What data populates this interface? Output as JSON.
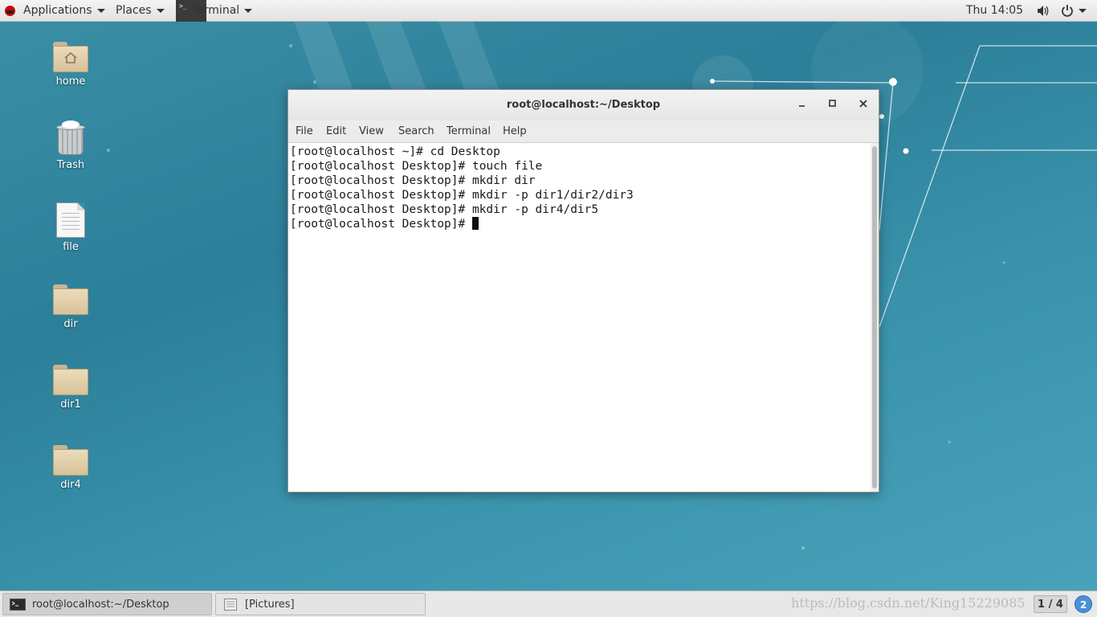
{
  "topbar": {
    "applications": "Applications",
    "places": "Places",
    "active_app": "Terminal",
    "clock": "Thu 14:05",
    "icons": [
      "redhat-logo-icon",
      "volume-icon",
      "power-icon",
      "chevron-down-icon"
    ]
  },
  "desktop": {
    "icons": [
      {
        "label": "home",
        "icon": "home-folder-icon"
      },
      {
        "label": "Trash",
        "icon": "trash-icon"
      },
      {
        "label": "file",
        "icon": "text-file-icon"
      },
      {
        "label": "dir",
        "icon": "folder-icon"
      },
      {
        "label": "dir1",
        "icon": "folder-icon"
      },
      {
        "label": "dir4",
        "icon": "folder-icon"
      }
    ]
  },
  "terminal_window": {
    "title": "root@localhost:~/Desktop",
    "controls": {
      "minimize": "minimize-icon",
      "maximize": "maximize-icon",
      "close": "close-icon"
    },
    "menu": [
      "File",
      "Edit",
      "View",
      "Search",
      "Terminal",
      "Help"
    ],
    "lines": [
      "[root@localhost ~]# cd Desktop",
      "[root@localhost Desktop]# touch file",
      "[root@localhost Desktop]# mkdir dir",
      "[root@localhost Desktop]# mkdir -p dir1/dir2/dir3",
      "[root@localhost Desktop]# mkdir -p dir4/dir5",
      "[root@localhost Desktop]# "
    ]
  },
  "taskbar": {
    "tasks": [
      {
        "label": "root@localhost:~/Desktop",
        "icon": "terminal-icon",
        "active": true
      },
      {
        "label": "[Pictures]",
        "icon": "file-manager-icon",
        "active": false
      }
    ],
    "watermark": "https://blog.csdn.net/King15229085",
    "workspace": "1 / 4",
    "notifications": "2"
  },
  "colors": {
    "desktop_bg": "#2c7f99",
    "topbar_bg": "#e8e8e8",
    "notification_badge": "#4a90d9"
  }
}
